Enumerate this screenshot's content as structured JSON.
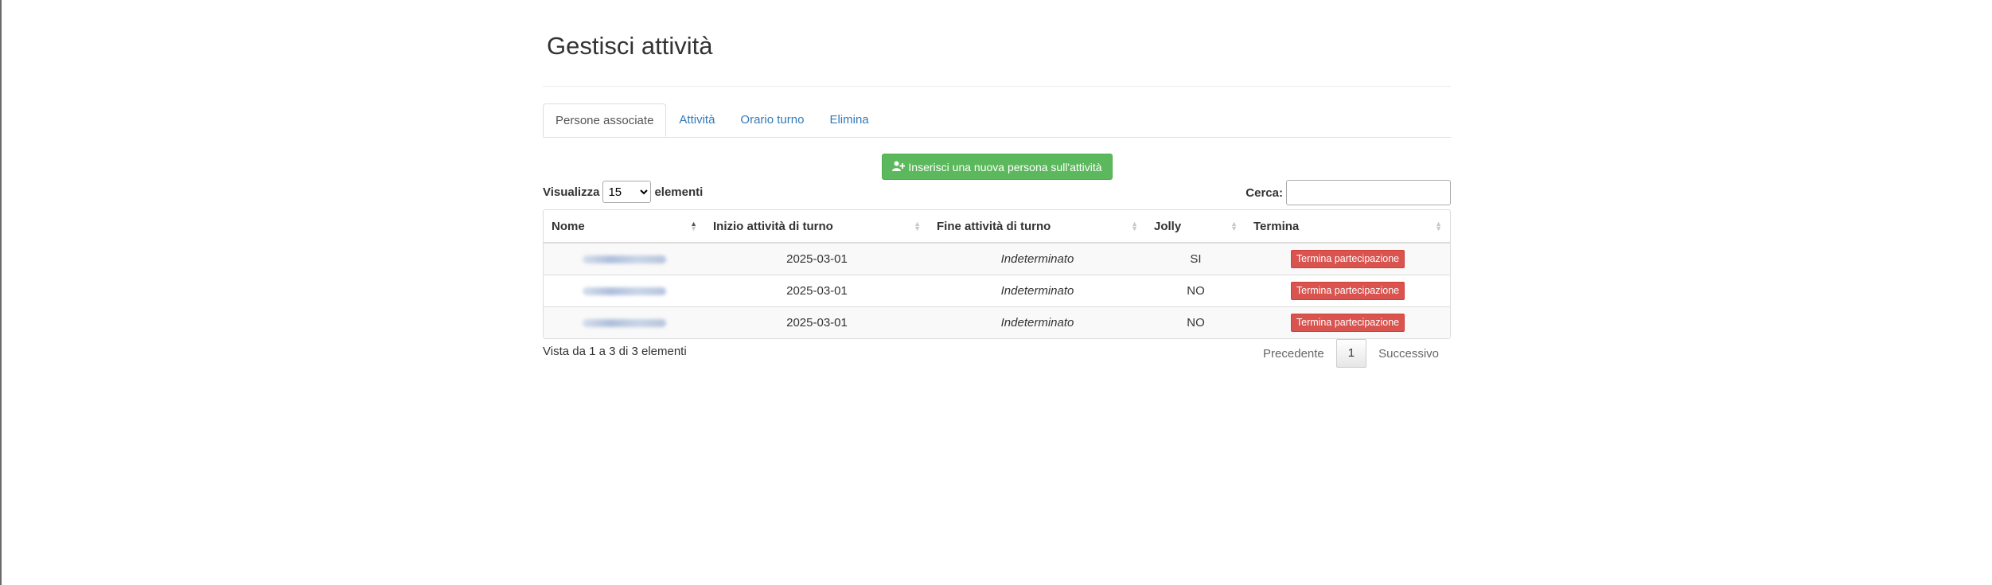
{
  "page": {
    "title": "Gestisci attività"
  },
  "tabs": [
    {
      "label": "Persone associate",
      "active": true
    },
    {
      "label": "Attività"
    },
    {
      "label": "Orario turno"
    },
    {
      "label": "Elimina"
    }
  ],
  "add_button": {
    "label": "Inserisci una nuova persona sull'attività",
    "icon": "user-plus-icon",
    "color": "#5cb85c"
  },
  "length": {
    "prefix": "Visualizza",
    "selected": "15",
    "suffix": "elementi"
  },
  "search": {
    "label": "Cerca:",
    "value": ""
  },
  "table": {
    "columns": [
      "Nome",
      "Inizio attività di turno",
      "Fine attività di turno",
      "Jolly",
      "Termina"
    ],
    "rows": [
      {
        "start": "2025-03-01",
        "end": "Indeterminato",
        "jolly": "SI",
        "action": "Termina partecipazione"
      },
      {
        "start": "2025-03-01",
        "end": "Indeterminato",
        "jolly": "NO",
        "action": "Termina partecipazione"
      },
      {
        "start": "2025-03-01",
        "end": "Indeterminato",
        "jolly": "NO",
        "action": "Termina partecipazione"
      }
    ]
  },
  "footer": {
    "info": "Vista da 1 a 3 di 3 elementi",
    "prev": "Precedente",
    "page": "1",
    "next": "Successivo"
  },
  "colors": {
    "link": "#337ab7",
    "danger": "#d9534f",
    "success": "#5cb85c"
  }
}
